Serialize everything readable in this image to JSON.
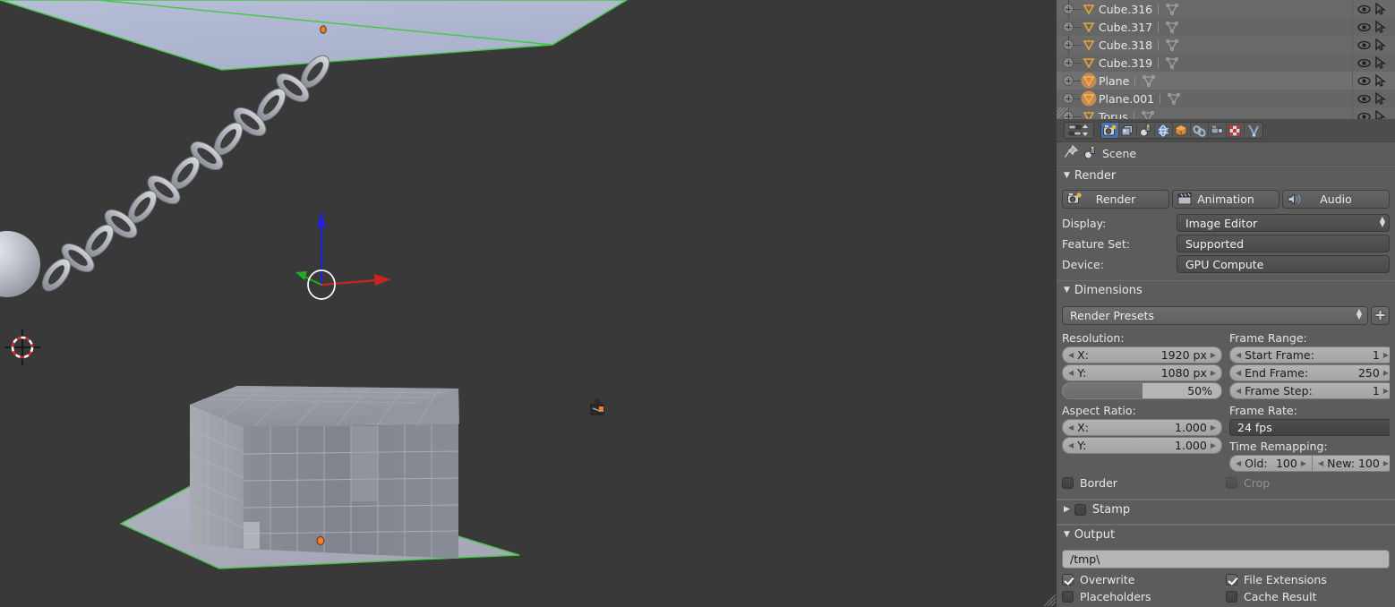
{
  "app": {
    "name": "Blender",
    "theme_bg": "#393939",
    "panel_bg": "#5c5c5c",
    "accent": "#4772b3"
  },
  "viewport": {
    "name": "3d-viewport",
    "background": "#393939",
    "objects": [
      {
        "name": "Plane",
        "type": "plane",
        "selected": true,
        "outline_color": "#46c846"
      },
      {
        "name": "Chain",
        "type": "chain",
        "selected": false
      },
      {
        "name": "Ball",
        "type": "sphere",
        "selected": false
      },
      {
        "name": "Cube grid",
        "type": "cube-array",
        "selected": false
      },
      {
        "name": "Plane.001",
        "type": "plane",
        "selected": true,
        "outline_color": "#46c846"
      },
      {
        "name": "Camera",
        "type": "camera",
        "selected": false
      }
    ],
    "manipulator": {
      "name": "translate-gizmo",
      "x_axis_color": "#cc2222",
      "y_axis_color": "#22aa22",
      "z_axis_color": "#2222dd"
    },
    "cursor_3d": {
      "name": "3d-cursor"
    }
  },
  "outliner": {
    "name": "outliner",
    "rows": [
      {
        "label": "Cube.316",
        "selected": false,
        "has_mesh": true
      },
      {
        "label": "Cube.317",
        "selected": false,
        "has_mesh": true
      },
      {
        "label": "Cube.318",
        "selected": false,
        "has_mesh": true
      },
      {
        "label": "Cube.319",
        "selected": false,
        "has_mesh": true
      },
      {
        "label": "Plane",
        "selected": true,
        "has_mesh": true
      },
      {
        "label": "Plane.001",
        "selected": true,
        "has_mesh": true
      },
      {
        "label": "Torus",
        "selected": false,
        "has_mesh": true
      }
    ],
    "icons": {
      "expand": "plus-icon",
      "object": "mesh-triangle-icon",
      "visibility": "eye-icon",
      "select": "cursor-arrow-icon"
    }
  },
  "properties": {
    "name": "properties-editor",
    "editor_type_icon": "editor-type-icon",
    "tabs": [
      {
        "name": "render",
        "icon": "camera-back-icon",
        "active": true
      },
      {
        "name": "render-layers",
        "icon": "images-icon",
        "active": false
      },
      {
        "name": "scene",
        "icon": "scene-icon",
        "active": false
      },
      {
        "name": "world",
        "icon": "world-globe-icon",
        "active": false
      },
      {
        "name": "object",
        "icon": "cube-icon",
        "active": false
      },
      {
        "name": "constraints",
        "icon": "chain-link-icon",
        "active": false
      },
      {
        "name": "modifiers",
        "icon": "wrench-icon",
        "active": false
      },
      {
        "name": "texture",
        "icon": "checker-icon",
        "active": false
      },
      {
        "name": "particles",
        "icon": "particles-icon",
        "active": false
      }
    ],
    "breadcrumb": {
      "pin_icon": "pin-icon",
      "scene_icon": "scene-icon",
      "scene_name": "Scene"
    },
    "panels": {
      "render": {
        "title": "Render",
        "expanded": true,
        "buttons": [
          {
            "label": "Render",
            "icon": "camera-render-icon"
          },
          {
            "label": "Animation",
            "icon": "clapperboard-icon"
          },
          {
            "label": "Audio",
            "icon": "speaker-icon"
          }
        ],
        "fields": [
          {
            "label": "Display:",
            "value": "Image Editor",
            "dropdown": true
          },
          {
            "label": "Feature Set:",
            "value": "Supported",
            "dropdown": false
          },
          {
            "label": "Device:",
            "value": "GPU Compute",
            "dropdown": false
          }
        ]
      },
      "dimensions": {
        "title": "Dimensions",
        "expanded": true,
        "preset": {
          "label": "Render Presets",
          "add_icon": "plus-icon"
        },
        "resolution": {
          "title": "Resolution:",
          "x": {
            "label": "X:",
            "value": "1920 px"
          },
          "y": {
            "label": "Y:",
            "value": "1080 px"
          },
          "percent": {
            "value": "50%",
            "fill": 50
          }
        },
        "aspect_ratio": {
          "title": "Aspect Ratio:",
          "x": {
            "label": "X:",
            "value": "1.000"
          },
          "y": {
            "label": "Y:",
            "value": "1.000"
          }
        },
        "frame_range": {
          "title": "Frame Range:",
          "start": {
            "label": "Start Frame:",
            "value": "1"
          },
          "end": {
            "label": "End Frame:",
            "value": "250"
          },
          "step": {
            "label": "Frame Step:",
            "value": "1"
          }
        },
        "frame_rate": {
          "title": "Frame Rate:",
          "value": "24 fps"
        },
        "time_remapping": {
          "title": "Time Remapping:",
          "old": {
            "label": "Old:",
            "value": "100"
          },
          "new": {
            "label": "New:",
            "value": "100"
          }
        },
        "border": {
          "label": "Border",
          "checked": false
        },
        "crop": {
          "label": "Crop",
          "checked": false,
          "disabled": true
        }
      },
      "stamp": {
        "title": "Stamp",
        "expanded": false,
        "checked": false
      },
      "output": {
        "title": "Output",
        "expanded": true,
        "path": "/tmp\\",
        "checkboxes": [
          {
            "label": "Overwrite",
            "checked": true
          },
          {
            "label": "File Extensions",
            "checked": true
          },
          {
            "label": "Placeholders",
            "checked": false
          },
          {
            "label": "Cache Result",
            "checked": false
          }
        ]
      }
    }
  }
}
